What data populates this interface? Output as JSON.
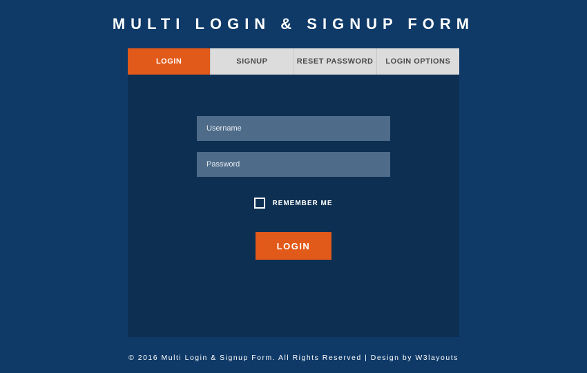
{
  "title": "MULTI LOGIN & SIGNUP FORM",
  "tabs": {
    "login": "LOGIN",
    "signup": "SIGNUP",
    "reset": "RESET PASSWORD",
    "options": "LOGIN OPTIONS"
  },
  "form": {
    "username_placeholder": "Username",
    "password_placeholder": "Password",
    "remember_label": "REMEMBER ME",
    "submit_label": "LOGIN"
  },
  "footer": "© 2016 Multi Login & Signup Form. All Rights Reserved | Design by W3layouts",
  "colors": {
    "page_bg": "#0f3a68",
    "panel_bg": "#0c2f52",
    "accent": "#e25a1a",
    "tab_inactive_bg": "#dcdcdc",
    "field_bg": "#4e6b89"
  }
}
